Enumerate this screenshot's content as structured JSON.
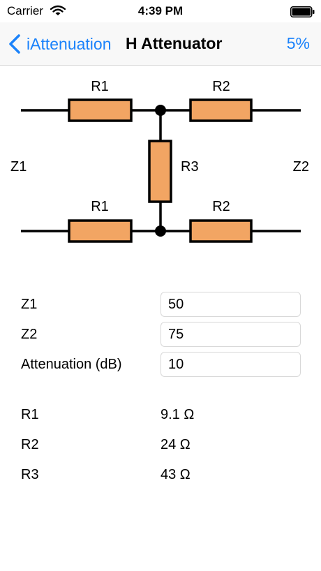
{
  "status_bar": {
    "carrier": "Carrier",
    "time": "4:39 PM"
  },
  "nav": {
    "back_label": "iAttenuation",
    "title": "H Attenuator",
    "right_label": "5%"
  },
  "diagram": {
    "r1_label": "R1",
    "r2_label": "R2",
    "r3_label": "R3",
    "z1_label": "Z1",
    "z2_label": "Z2"
  },
  "inputs": [
    {
      "label": "Z1",
      "value": "50"
    },
    {
      "label": "Z2",
      "value": "75"
    },
    {
      "label": "Attenuation (dB)",
      "value": "10"
    }
  ],
  "results": [
    {
      "label": "R1",
      "value": "9.1 Ω"
    },
    {
      "label": "R2",
      "value": "24 Ω"
    },
    {
      "label": "R3",
      "value": "43 Ω"
    }
  ],
  "colors": {
    "accent": "#1a82fb",
    "resistor_fill": "#f2a563"
  },
  "icons": [
    "wifi-icon",
    "battery-icon",
    "chevron-left-icon"
  ]
}
